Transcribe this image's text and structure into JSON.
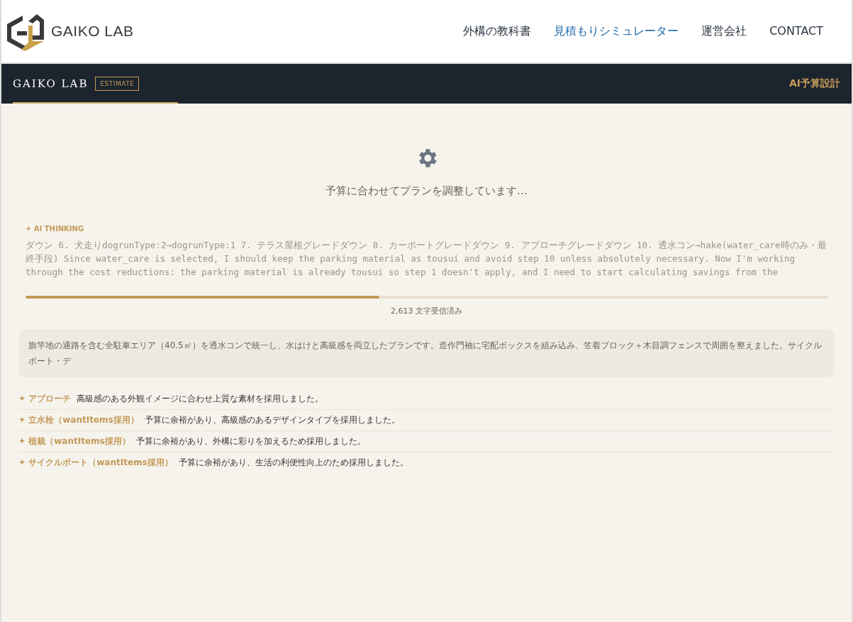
{
  "site_header": {
    "logo_text": "GAIKO LAB",
    "nav": [
      {
        "label": "外構の教科書",
        "selected": false
      },
      {
        "label": "見積もりシミュレーター",
        "selected": true
      },
      {
        "label": "運営会社",
        "selected": false
      },
      {
        "label": "CONTACT",
        "selected": false
      }
    ]
  },
  "app_bar": {
    "brand": "GAIKO LAB",
    "badge": "ESTIMATE",
    "title": "AI予算設計"
  },
  "status": {
    "message": "予算に合わせてプランを調整しています…"
  },
  "thinking": {
    "label": "✦ AI THINKING",
    "text": "ダウン 6. 犬走りdogrunType:2→dogrunType:1 7. テラス屋根グレードダウン 8. カーポートグレードダウン 9. アプローチグレードダウン 10. 透水コン→hake(water_care時のみ・最終手段) Since water_care is selected, I should keep the parking material as tousui and avoid step 10 unless absolutely necessary. Now I'm working through the cost reductions: the parking material is already tousui so step 1 doesn't apply, and I need to start calculating savings from the"
  },
  "progress": {
    "level": 0.44,
    "reading": "2,613 文字受信済み"
  },
  "summary": "旗竿地の通路を含む全駐車エリア（40.5㎡）を透水コンで統一し、水はけと高級感を両立したプランです。造作門袖に宅配ボックスを組み込み、笠着ブロック＋木目調フェンスで周囲を整えました。サイクルポート・デ",
  "reasons": [
    {
      "title": "✦ アプローチ",
      "text": "高級感のある外観イメージに合わせ上質な素材を採用しました。"
    },
    {
      "title": "✦ 立水栓（wantItems採用）",
      "text": "予算に余裕があり、高級感のあるデザインタイプを採用しました。"
    },
    {
      "title": "✦ 植栽（wantItems採用）",
      "text": "予算に余裕があり、外構に彩りを加えるため採用しました。"
    },
    {
      "title": "✦ サイクルポート（wantItems採用）",
      "text": "予算に余裕があり、生活の利便性向上のため採用しました。"
    }
  ]
}
